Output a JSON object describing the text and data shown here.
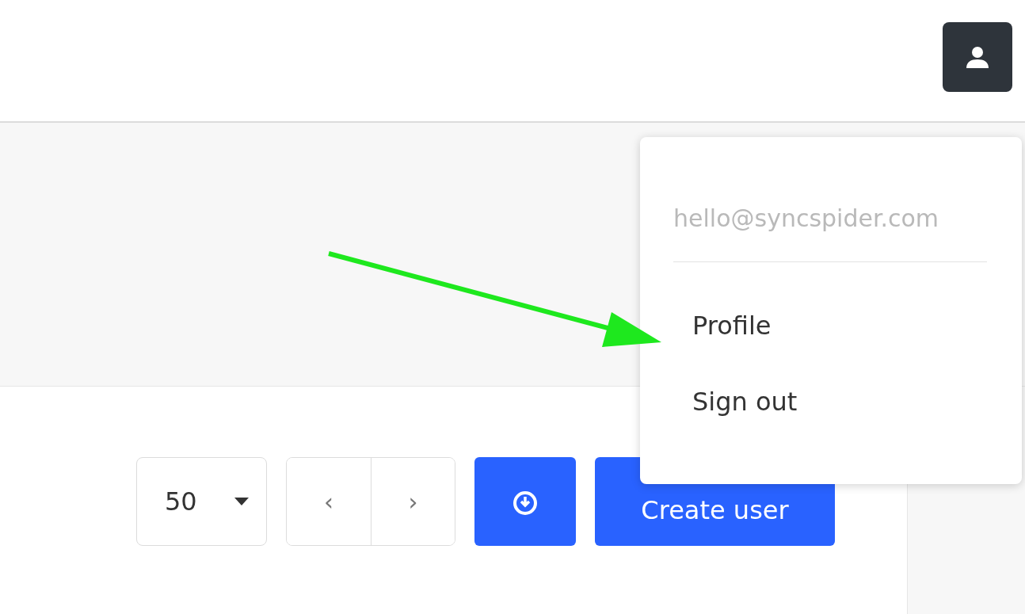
{
  "user_menu": {
    "email": "hello@syncspider.com",
    "items": [
      {
        "label": "Profile"
      },
      {
        "label": "Sign out"
      }
    ]
  },
  "toolbar": {
    "page_size": "50",
    "pager": [
      "‹",
      "›"
    ],
    "create_button": "Create user"
  }
}
